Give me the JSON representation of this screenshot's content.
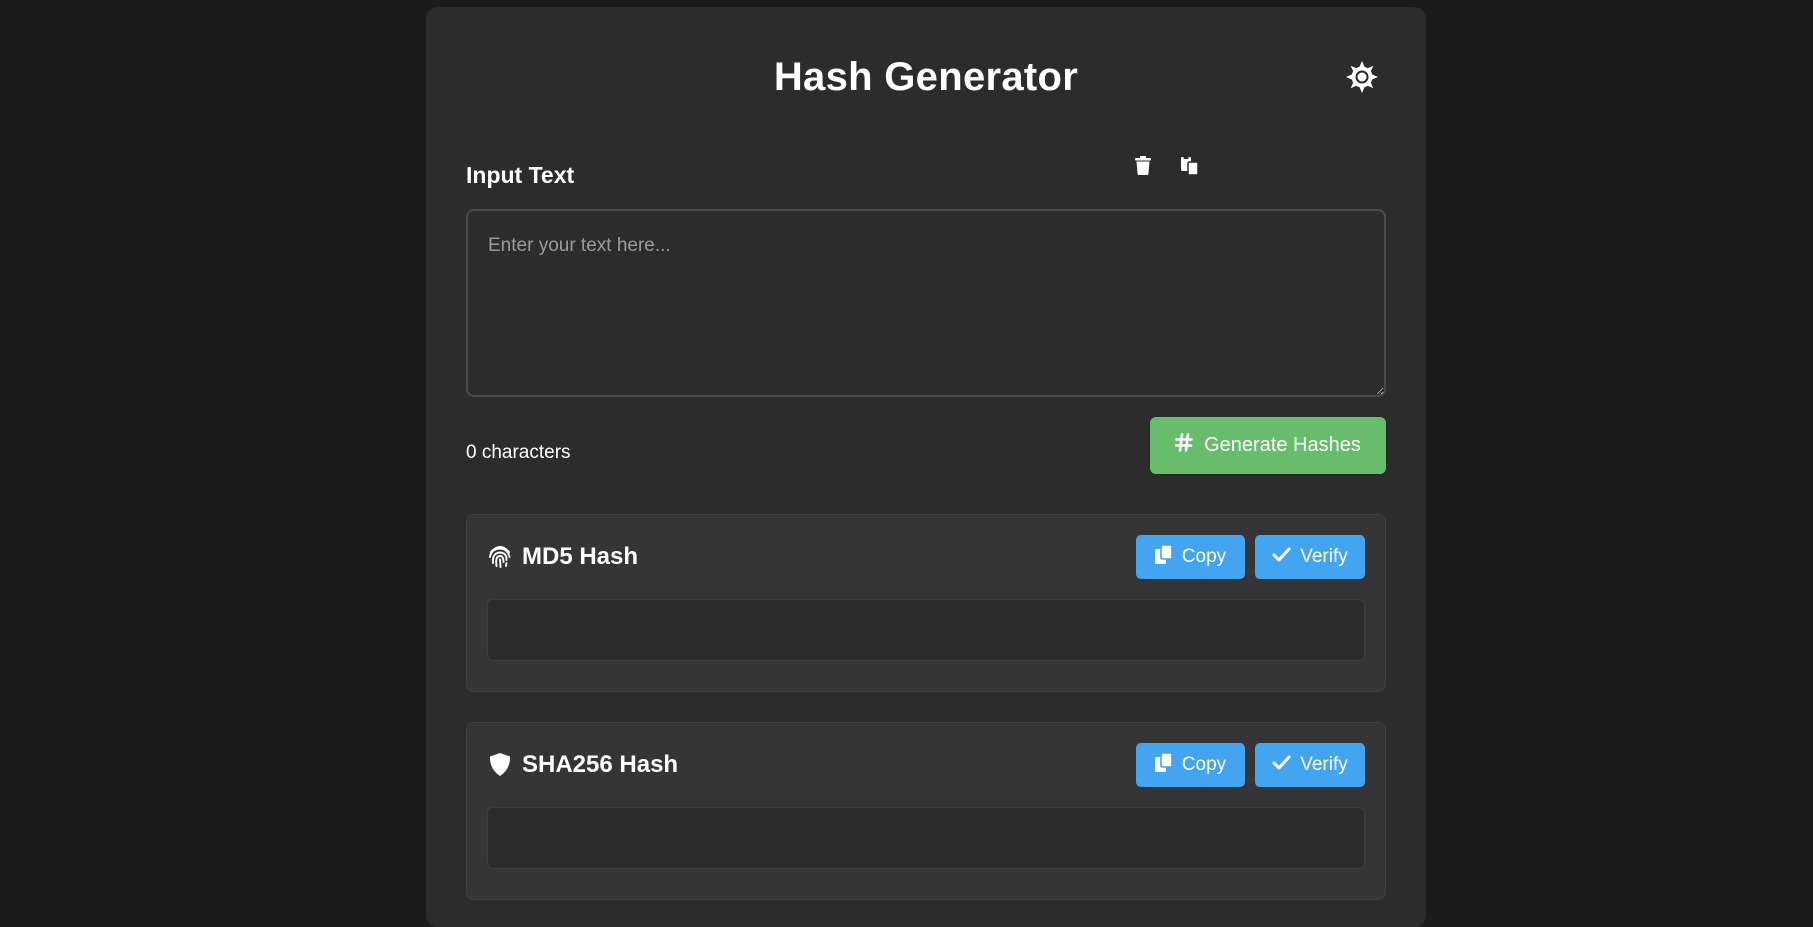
{
  "header": {
    "title": "Hash Generator",
    "theme_icon": "gear-icon"
  },
  "input": {
    "label": "Input Text",
    "placeholder": "Enter your text here...",
    "value": "",
    "clear_icon": "trash-icon",
    "paste_icon": "paste-icon",
    "char_count": "0 characters"
  },
  "generate": {
    "label": "Generate Hashes",
    "icon": "hash-icon",
    "color": "#67bd6c"
  },
  "hashes": [
    {
      "title": "MD5 Hash",
      "icon": "fingerprint-icon",
      "copy_label": "Copy",
      "verify_label": "Verify",
      "value": ""
    },
    {
      "title": "SHA256 Hash",
      "icon": "shield-icon",
      "copy_label": "Copy",
      "verify_label": "Verify",
      "value": ""
    }
  ],
  "colors": {
    "background": "#1b1b1b",
    "panel": "#2c2c2c",
    "card": "#353535",
    "accent_blue": "#43a4f0",
    "accent_green": "#67bd6c"
  }
}
